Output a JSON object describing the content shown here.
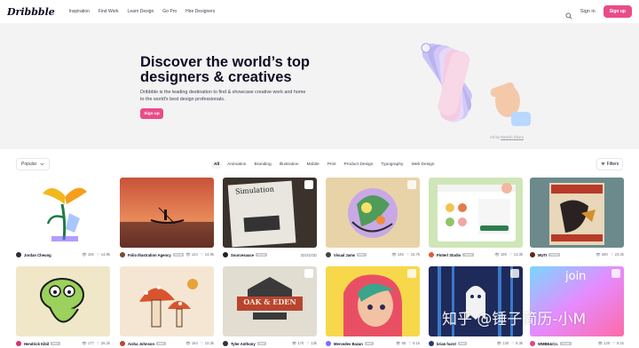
{
  "header": {
    "logo": "Dribbble",
    "nav": [
      "Inspiration",
      "Find Work",
      "Learn Design",
      "Go Pro",
      "Hire Designers"
    ],
    "signin": "Sign in",
    "signup": "Sign up"
  },
  "hero": {
    "title": "Discover the world’s top designers & creatives",
    "subtitle": "Dribbble is the leading destination to find & showcase creative work and home to the world's best design professionals.",
    "button": "Sign up",
    "credit_prefix": "Art by",
    "credit_author": "Ramón Shuro"
  },
  "filters": {
    "sort": "Popular",
    "categories": [
      "All",
      "Animation",
      "Branding",
      "Illustration",
      "Mobile",
      "Print",
      "Product Design",
      "Typography",
      "Web Design"
    ],
    "active_category": "All",
    "filters_label": "Filters"
  },
  "shots": [
    {
      "author": "Jordan Cheung",
      "badge": "",
      "views": "105",
      "likes": "14.9k",
      "avatar_color": "#2e2e38"
    },
    {
      "author": "Folio Illustration Agency",
      "badge": "TEAM",
      "views": "124",
      "likes": "14.9k",
      "avatar_color": "#7a4a2a"
    },
    {
      "author": "Sourcesauce",
      "badge": "TEAM",
      "views": "",
      "likes": "",
      "extra": "3D/2D/3D",
      "avatar_color": "#222222"
    },
    {
      "author": "Visual Jams",
      "badge": "PRO",
      "views": "146",
      "likes": "15.7k",
      "avatar_color": "#444444"
    },
    {
      "author": "Pinterl Studio",
      "badge": "TEAM",
      "views": "159",
      "likes": "13.3k",
      "avatar_color": "#e25b3a"
    },
    {
      "author": "MUTI",
      "badge": "TEAM",
      "views": "280",
      "likes": "23.2k",
      "avatar_color": "#5a2a1a"
    },
    {
      "author": "Hendrick Kibil",
      "badge": "PRO",
      "views": "177",
      "likes": "26.2k",
      "avatar_color": "#d6336c"
    },
    {
      "author": "Aisha Johnson",
      "badge": "PRO",
      "views": "164",
      "likes": "10.3k",
      "avatar_color": "#b5473d"
    },
    {
      "author": "Tyler Anthony",
      "badge": "PRO",
      "views": "170",
      "likes": "13k",
      "avatar_color": "#333333"
    },
    {
      "author": "Mercedes Bazan",
      "badge": "PRO",
      "views": "85",
      "likes": "9.1k",
      "avatar_color": "#7c6cff"
    },
    {
      "author": "brian hurst",
      "badge": "PRO",
      "views": "130",
      "likes": "8.3k",
      "avatar_color": "#2a3a6a"
    },
    {
      "author": "WMBE&Co.",
      "badge": "TEAM",
      "views": "120",
      "likes": "8.1k",
      "avatar_color": "#d44a8a"
    }
  ],
  "shot_texts": {
    "simulation": "Simulation",
    "oak_eden": "OAK & EDEN",
    "join": "join"
  },
  "watermark": "知乎 @锤子简历-小M",
  "colors": {
    "brand_pink": "#ea4c89",
    "hero_bg": "#f3f3f4"
  }
}
